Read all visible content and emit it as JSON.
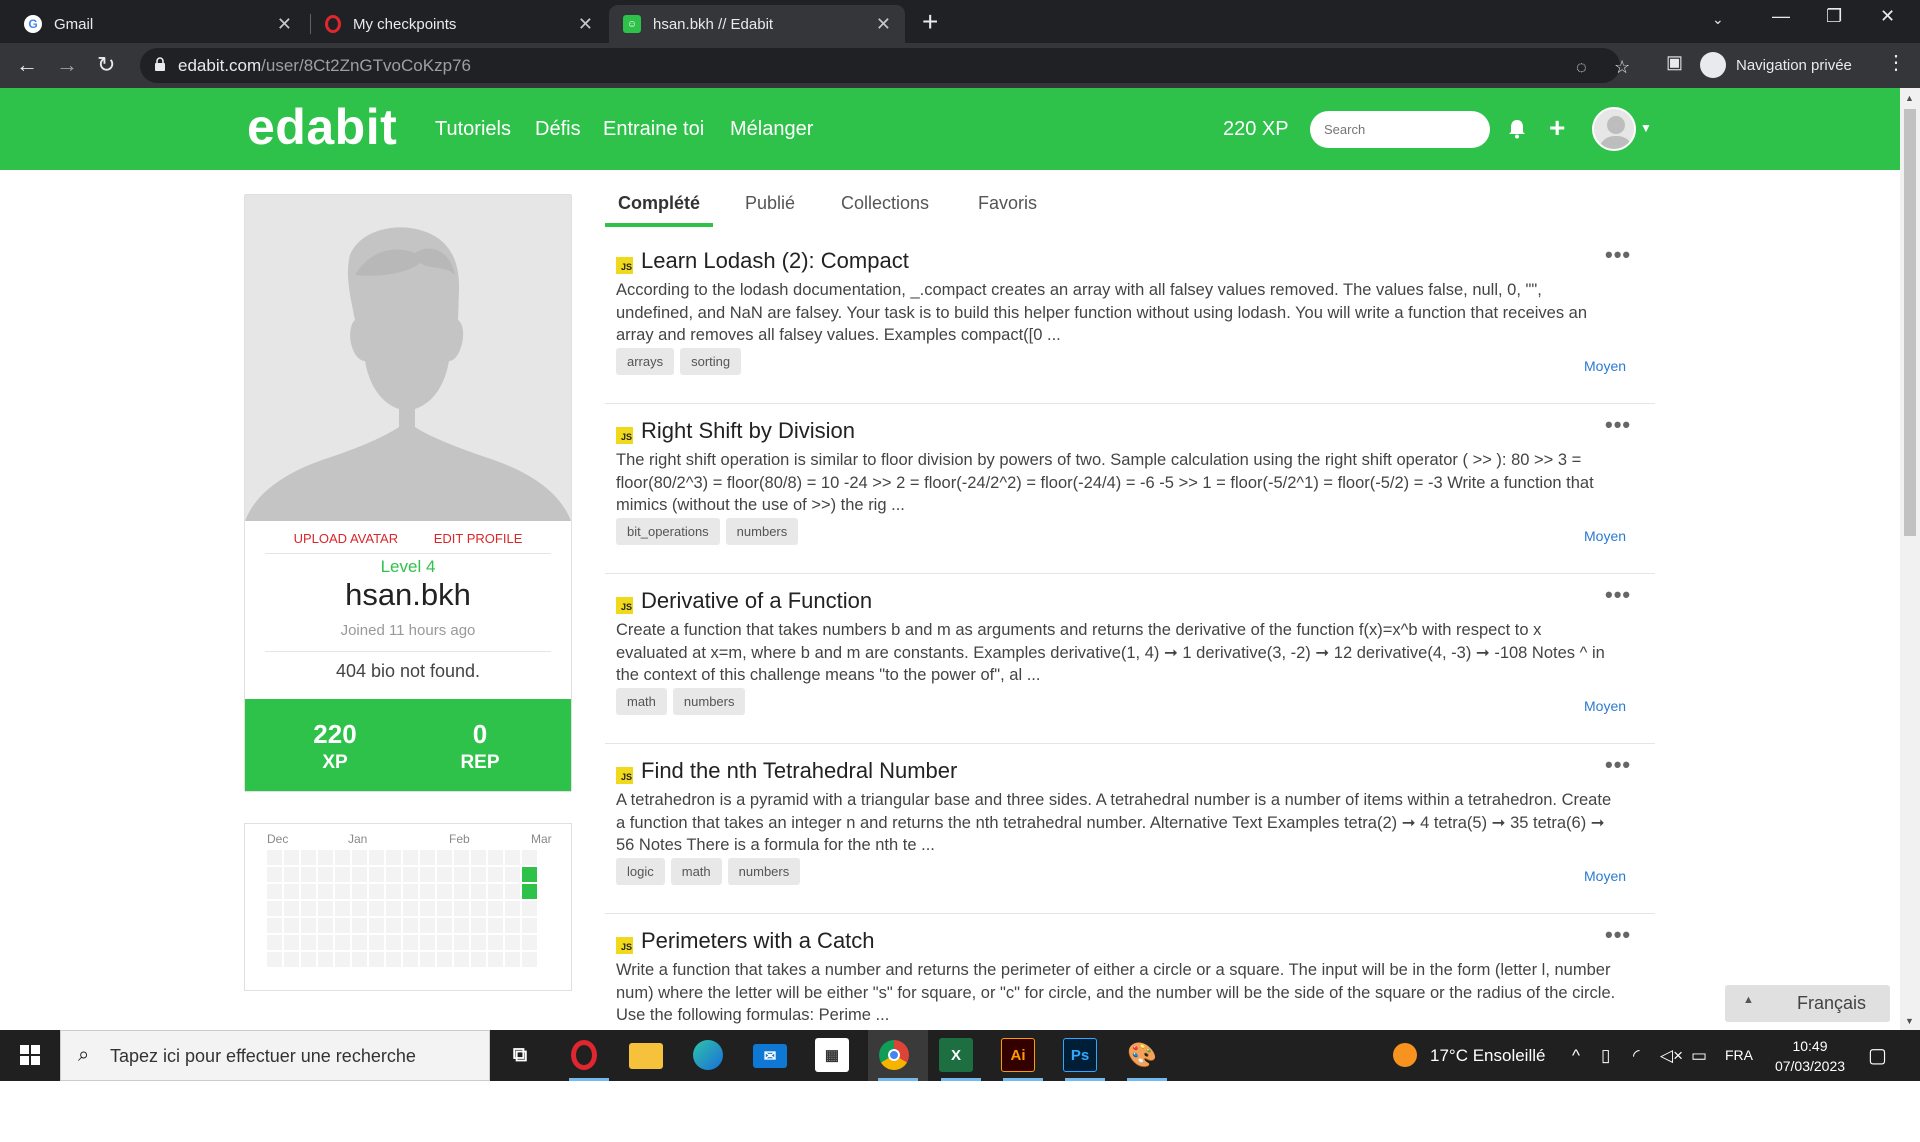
{
  "browser": {
    "tabs": [
      {
        "title": "Gmail"
      },
      {
        "title": "My checkpoints"
      },
      {
        "title": "hsan.bkh // Edabit"
      }
    ],
    "url_host": "edabit.com",
    "url_path": "/user/8Ct2ZnGTvoCoKzp76",
    "incognito_label": "Navigation privée"
  },
  "site": {
    "logo": "edabit",
    "nav_links": [
      "Tutoriels",
      "Défis",
      "Entraine toi",
      "Mélanger"
    ],
    "xp_label": "220 XP",
    "search_placeholder": "Search"
  },
  "profile": {
    "upload_avatar": "UPLOAD AVATAR",
    "edit_profile": "EDIT PROFILE",
    "level": "Level 4",
    "username": "hsan.bkh",
    "joined": "Joined 11 hours ago",
    "bio": "404 bio not found.",
    "xp_value": "220",
    "xp_label": "XP",
    "rep_value": "0",
    "rep_label": "REP"
  },
  "activity": {
    "months": [
      "Dec",
      "Jan",
      "Feb",
      "Mar"
    ],
    "active_color": "#2ec24b"
  },
  "profile_tabs": [
    "Complété",
    "Publié",
    "Collections",
    "Favoris"
  ],
  "challenges": [
    {
      "title": "Learn Lodash (2): Compact",
      "description": "According to the lodash documentation, _.compact creates an array with all falsey values removed. The values false, null, 0, \"\", undefined, and NaN are falsey. Your task is to build this helper function without using lodash. You will write a function that receives an array and removes all falsey values. Examples compact([0 ...",
      "tags": [
        "arrays",
        "sorting"
      ],
      "difficulty": "Moyen"
    },
    {
      "title": "Right Shift by Division",
      "description": "The right shift operation is similar to floor division by powers of two. Sample calculation using the right shift operator ( >> ): 80 >> 3 = floor(80/2^3) = floor(80/8) = 10 -24 >> 2 = floor(-24/2^2) = floor(-24/4) = -6 -5 >> 1 = floor(-5/2^1) = floor(-5/2) = -3 Write a function that mimics (without the use of >>) the rig ...",
      "tags": [
        "bit_operations",
        "numbers"
      ],
      "difficulty": "Moyen"
    },
    {
      "title": "Derivative of a Function",
      "description": "Create a function that takes numbers b and m as arguments and returns the derivative of the function f(x)=x^b with respect to x evaluated at x=m, where b and m are constants. Examples derivative(1, 4) ➞ 1 derivative(3, -2) ➞ 12 derivative(4, -3) ➞ -108 Notes ^ in the context of this challenge means \"to the power of\", al ...",
      "tags": [
        "math",
        "numbers"
      ],
      "difficulty": "Moyen"
    },
    {
      "title": "Find the nth Tetrahedral Number",
      "description": "A tetrahedron is a pyramid with a triangular base and three sides. A tetrahedral number is a number of items within a tetrahedron. Create a function that takes an integer n and returns the nth tetrahedral number. Alternative Text Examples tetra(2) ➞ 4 tetra(5) ➞ 35 tetra(6) ➞ 56 Notes There is a formula for the nth te ...",
      "tags": [
        "logic",
        "math",
        "numbers"
      ],
      "difficulty": "Moyen"
    },
    {
      "title": "Perimeters with a Catch",
      "description": "Write a function that takes a number and returns the perimeter of either a circle or a square. The input will be in the form (letter l, number num) where the letter will be either \"s\" for square, or \"c\" for circle, and the number will be the side of the square or the radius of the circle. Use the following formulas: Perime ...",
      "tags": [],
      "difficulty": ""
    }
  ],
  "language_selector": "Français",
  "taskbar": {
    "search_placeholder": "Tapez ici pour effectuer une recherche",
    "weather": "17°C Ensoleillé",
    "lang": "FRA",
    "time": "10:49",
    "date": "07/03/2023"
  }
}
